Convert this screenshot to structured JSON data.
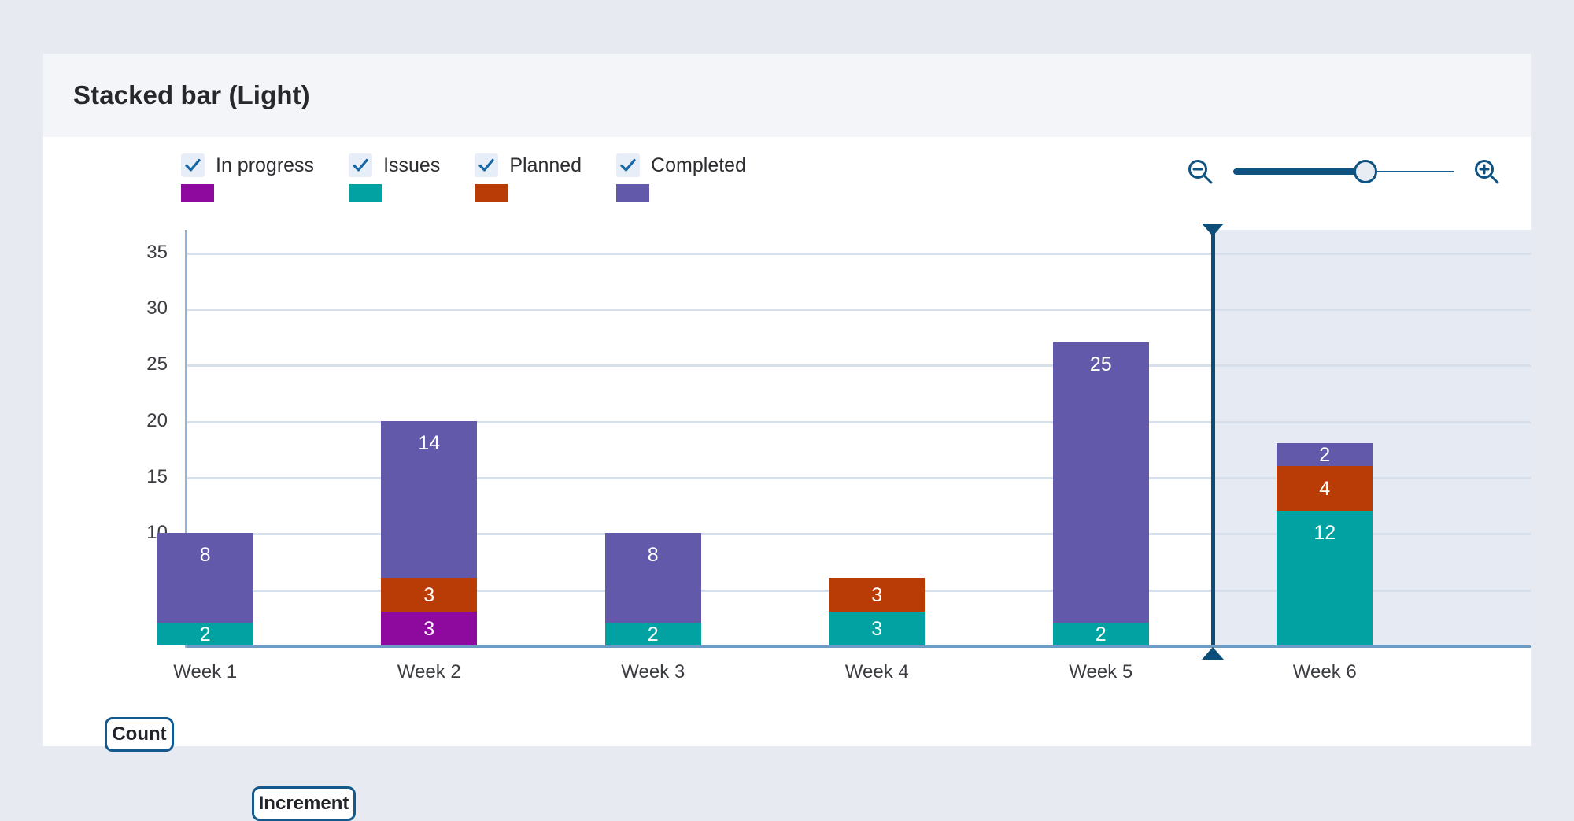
{
  "card": {
    "title": "Stacked bar (Light)"
  },
  "toolbar": {
    "legend": [
      {
        "label": "In progress",
        "color": "#8e0a9e",
        "checked": true,
        "icon": "checkbox-checked-icon"
      },
      {
        "label": "Issues",
        "color": "#03a2a2",
        "checked": true,
        "icon": "checkbox-checked-icon"
      },
      {
        "label": "Planned",
        "color": "#b93c06",
        "checked": true,
        "icon": "checkbox-checked-icon"
      },
      {
        "label": "Completed",
        "color": "#6259ab",
        "checked": true,
        "icon": "checkbox-checked-icon"
      }
    ],
    "zoom_out_icon": "zoom-out-icon",
    "zoom_in_icon": "zoom-in-icon",
    "slider_value": 60
  },
  "axis_buttons": {
    "y_label": "Count",
    "x_label": "Increment"
  },
  "chart_data": {
    "type": "bar",
    "stacked": true,
    "title": "Stacked bar (Light)",
    "xlabel": "Increment",
    "ylabel": "Count",
    "categories": [
      "Week 1",
      "Week 2",
      "Week 3",
      "Week 4",
      "Week 5",
      "Week 6"
    ],
    "ylim": [
      0,
      37
    ],
    "yticks": [
      5,
      10,
      15,
      20,
      25,
      30,
      35
    ],
    "grid": true,
    "legend_position": "top-left",
    "series": [
      {
        "name": "In progress",
        "color": "#8e0a9e",
        "values": [
          0,
          3,
          0,
          0,
          0,
          0
        ]
      },
      {
        "name": "Issues",
        "color": "#03a2a2",
        "values": [
          2,
          0,
          2,
          3,
          2,
          12
        ]
      },
      {
        "name": "Planned",
        "color": "#b93c06",
        "values": [
          0,
          3,
          0,
          3,
          0,
          4
        ]
      },
      {
        "name": "Completed",
        "color": "#6259ab",
        "values": [
          8,
          14,
          8,
          0,
          25,
          2
        ]
      }
    ],
    "totals": [
      10,
      20,
      10,
      6,
      27,
      18
    ],
    "selection": {
      "from_category": "Week 6",
      "shaded": true,
      "handle_color": "#0d4e78"
    }
  },
  "colors": {
    "page_background": "#e7eaf1",
    "card_background": "#ffffff",
    "header_background": "#f4f5f9",
    "gridline": "#d7dfeb",
    "axis": "#6f9cc4",
    "accent": "#0f5382",
    "selection_band": "#e6eaf2"
  }
}
